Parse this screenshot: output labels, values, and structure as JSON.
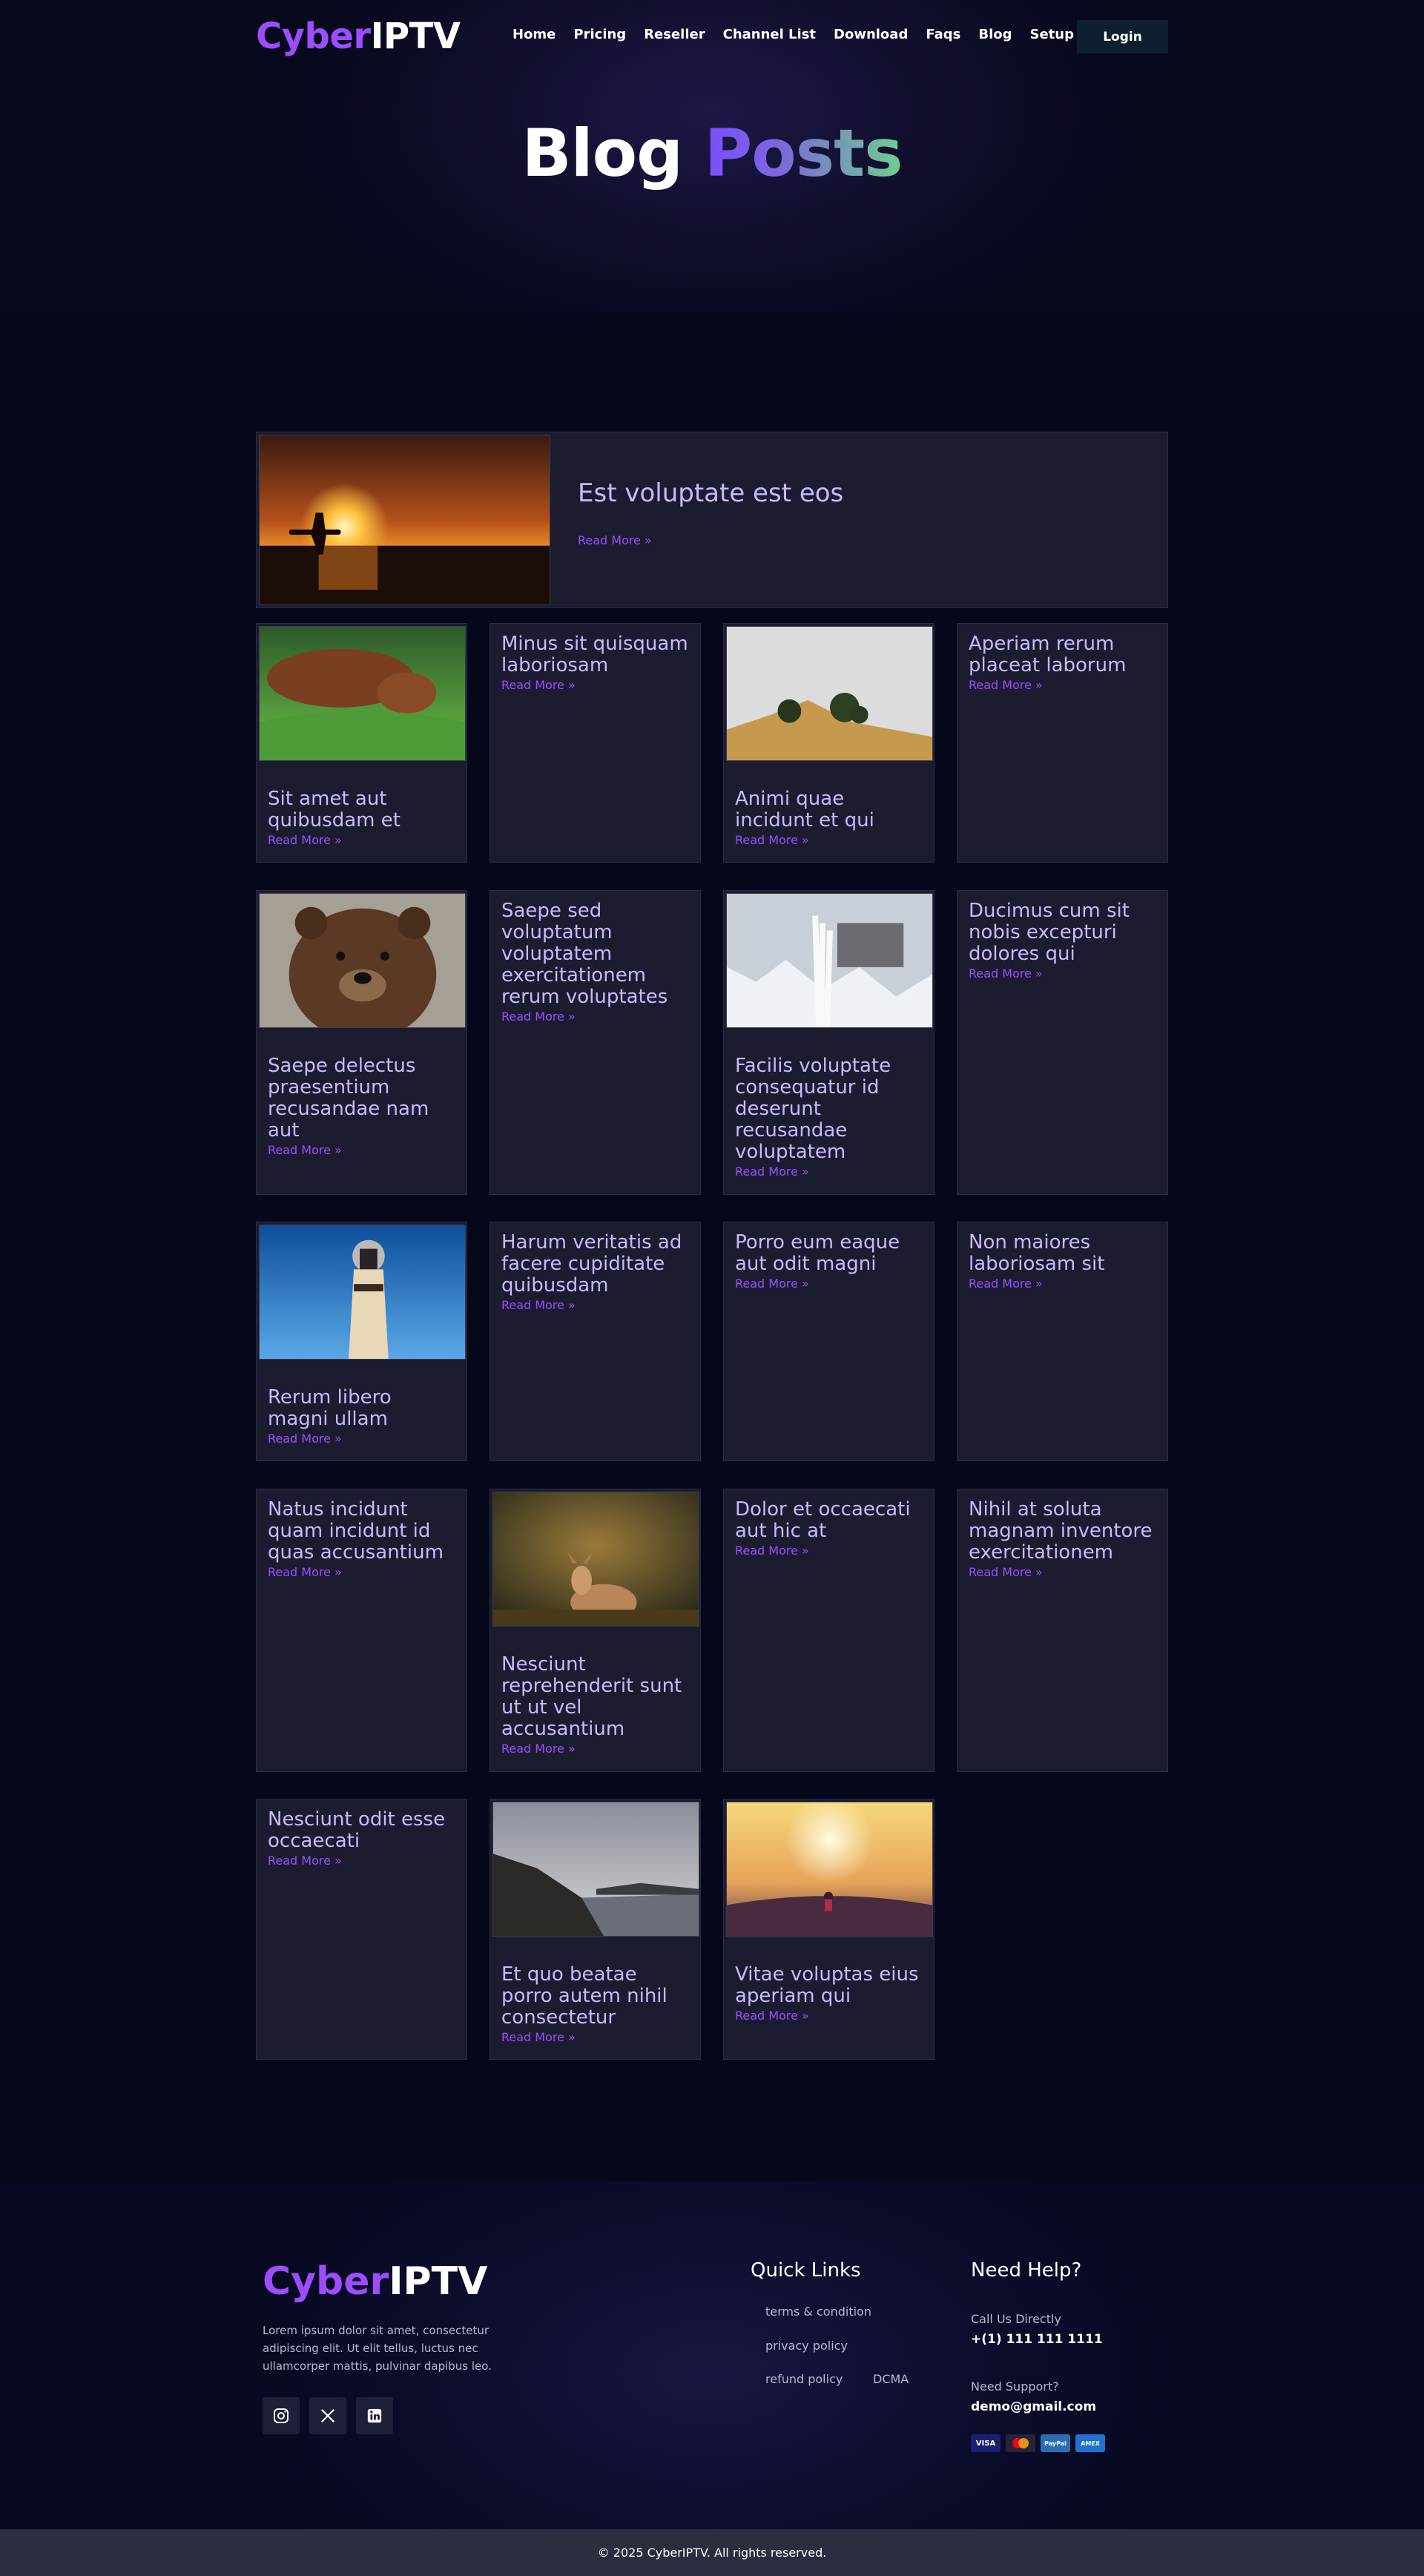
{
  "brand": {
    "part1": "Cyber",
    "part2": "IPTV"
  },
  "nav": {
    "items": [
      "Home",
      "Pricing",
      "Reseller",
      "Channel List",
      "Download",
      "Faqs",
      "Blog",
      "Setup"
    ],
    "login": "Login"
  },
  "hero": {
    "title_white": "Blog ",
    "title_gradient": "Posts"
  },
  "featured": {
    "title": "Est voluptate est eos",
    "read_more": "Read More »"
  },
  "posts": [
    {
      "title": "Sit amet aut quibusdam et",
      "read_more": "Read More »"
    },
    {
      "title": "Minus sit quisquam laboriosam",
      "read_more": "Read More »"
    },
    {
      "title": "Animi quae incidunt et qui",
      "read_more": "Read More »"
    },
    {
      "title": "Aperiam rerum placeat laborum",
      "read_more": "Read More »"
    },
    {
      "title": "Saepe delectus praesentium recusandae nam aut",
      "read_more": "Read More »"
    },
    {
      "title": "Saepe sed voluptatum voluptatem exercitationem rerum voluptates",
      "read_more": "Read More »"
    },
    {
      "title": "Facilis voluptate consequatur id deserunt recusandae voluptatem",
      "read_more": "Read More »"
    },
    {
      "title": "Ducimus cum sit nobis excepturi dolores qui",
      "read_more": "Read More »"
    },
    {
      "title": "Rerum libero magni ullam",
      "read_more": "Read More »"
    },
    {
      "title": "Harum veritatis ad facere cupiditate quibusdam",
      "read_more": "Read More »"
    },
    {
      "title": "Porro eum eaque aut odit magni",
      "read_more": "Read More »"
    },
    {
      "title": "Non maiores laboriosam sit",
      "read_more": "Read More »"
    },
    {
      "title": "Natus incidunt quam incidunt id quas accusantium",
      "read_more": "Read More »"
    },
    {
      "title": "Nesciunt reprehenderit sunt ut ut vel accusantium",
      "read_more": "Read More »"
    },
    {
      "title": "Dolor et occaecati aut hic at",
      "read_more": "Read More »"
    },
    {
      "title": "Nihil at soluta magnam inventore exercitationem",
      "read_more": "Read More »"
    },
    {
      "title": "Nesciunt odit esse occaecati",
      "read_more": "Read More »"
    },
    {
      "title": "Et quo beatae porro autem nihil consectetur",
      "read_more": "Read More »"
    },
    {
      "title": "Vitae voluptas eius aperiam qui",
      "read_more": "Read More »"
    }
  ],
  "footer": {
    "description": "Lorem ipsum dolor sit amet, consectetur adipiscing elit. Ut elit tellus, luctus nec ullamcorper mattis, pulvinar dapibus leo.",
    "quick_links_heading": "Quick Links",
    "links": [
      "terms & condition",
      "privacy policy",
      "refund policy",
      "DCMA"
    ],
    "help_heading": "Need Help?",
    "call_label": "Call Us Directly",
    "phone": "+(1) 111 111 1111",
    "support_label": "Need Support?",
    "email": "demo@gmail.com",
    "payments": [
      "VISA",
      "MC",
      "PayPal",
      "AMEX"
    ],
    "copyright": "© 2025 CyberIPTV. All rights reserved."
  },
  "colors": {
    "accent": "#9b4dff",
    "card_bg": "#1b1c2f",
    "title_color": "#c9b8ff",
    "page_bg": "#05081a"
  }
}
